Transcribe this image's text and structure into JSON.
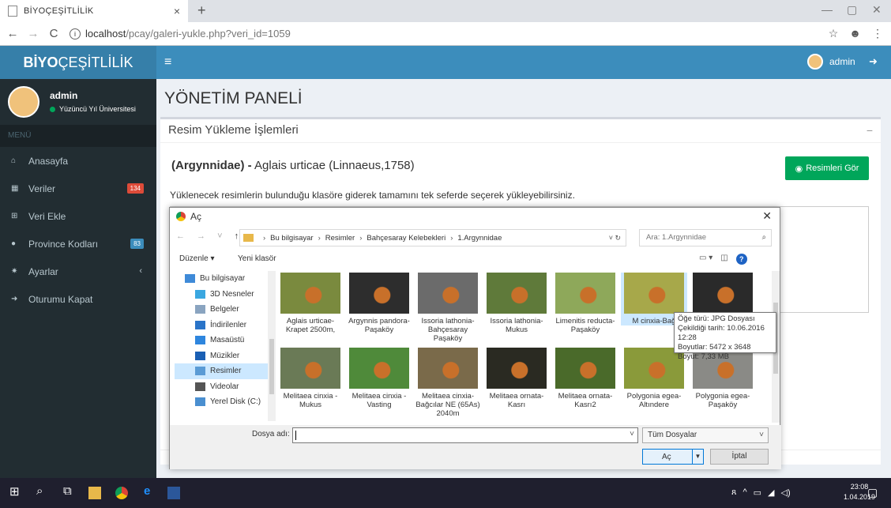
{
  "browser": {
    "tab_title": "BİYOÇEŞİTLİLİK",
    "tab_close": "×",
    "new_tab": "+",
    "url_host": "localhost",
    "url_path": "/pcay/galeri-yukle.php?veri_id=1059",
    "window_min": "—",
    "window_max": "▢",
    "window_close": "✕"
  },
  "app": {
    "brand_bold": "BİYO",
    "brand_rest": "ÇEŞİTLİLİK",
    "menu_toggle": "≡",
    "top_user": "admin",
    "colors": {
      "brand": "#367fa9",
      "header": "#3c8dbc",
      "sidebar": "#222d32",
      "success": "#00a65a",
      "danger": "#dd4b39"
    }
  },
  "sidebar": {
    "user_name": "admin",
    "user_status": "Yüzüncü Yıl Üniversitesi",
    "menu_header": "MENÜ",
    "items": [
      {
        "label": "Anasayfa",
        "icon": "home-icon",
        "glyph": "⌂"
      },
      {
        "label": "Veriler",
        "icon": "table-icon",
        "glyph": "▦",
        "badge": "134",
        "badge_color": "#dd4b39"
      },
      {
        "label": "Veri Ekle",
        "icon": "plus-square-icon",
        "glyph": "⊞"
      },
      {
        "label": "Province Kodları",
        "icon": "map-marker-icon",
        "glyph": "●",
        "badge": "83",
        "badge_color": "#3c8dbc"
      },
      {
        "label": "Ayarlar",
        "icon": "gear-icon",
        "glyph": "✷",
        "chevron": "‹"
      },
      {
        "label": "Oturumu Kapat",
        "icon": "sign-out-icon",
        "glyph": "➜"
      }
    ]
  },
  "main": {
    "page_title": "YÖNETİM PANELİ",
    "box_title": "Resim Yükleme İşlemleri",
    "collapse": "−",
    "family": "(Argynnidae) -",
    "species": "Aglais urticae (Linnaeus,1758)",
    "view_button": "Resimleri Gör",
    "instruction": "Yüklenecek resimlerin bulunduğu klasöre giderek tamamını tek seferde seçerek yükleyebilirsiniz."
  },
  "dialog": {
    "title": "Aç",
    "close": "✕",
    "breadcrumb": [
      "Bu bilgisayar",
      "Resimler",
      "Bahçesaray Kelebekleri",
      "1.Argynnidae"
    ],
    "search_placeholder": "Ara: 1.Argynnidae",
    "organize": "Düzenle ▾",
    "new_folder": "Yeni klasör",
    "nav_items": [
      {
        "label": "Bu bilgisayar",
        "color": "#3f8ad8"
      },
      {
        "label": "3D Nesneler",
        "color": "#3aa7e0"
      },
      {
        "label": "Belgeler",
        "color": "#8aa4c0"
      },
      {
        "label": "İndirilenler",
        "color": "#2a74c8"
      },
      {
        "label": "Masaüstü",
        "color": "#2e86de"
      },
      {
        "label": "Müzikler",
        "color": "#1a5fb4"
      },
      {
        "label": "Resimler",
        "color": "#5a9bd5",
        "selected": true
      },
      {
        "label": "Videolar",
        "color": "#555555"
      },
      {
        "label": "Yerel Disk (C:)",
        "color": "#4a8fd0"
      }
    ],
    "files": [
      {
        "label": "Aglais urticae-Krapet 2500m,",
        "bg": "#7a8a3e"
      },
      {
        "label": "Argynnis pandora-Paşaköy",
        "bg": "#2d2d2d"
      },
      {
        "label": "Issoria lathonia-Bahçesaray Paşaköy",
        "bg": "#6b6b6b"
      },
      {
        "label": "Issoria lathonia-Mukus",
        "bg": "#5f7a3a"
      },
      {
        "label": "Limenitis reducta-Paşaköy",
        "bg": "#8ea85a"
      },
      {
        "label": "M cinxia-Bağ",
        "bg": "#a7a84a",
        "selected": true
      },
      {
        "label": "",
        "bg": "#2a2a2a"
      },
      {
        "label": "Melitaea cinxia -Mukus",
        "bg": "#6a7a56"
      },
      {
        "label": "Melitaea cinxia -Vasting",
        "bg": "#4f8a3a"
      },
      {
        "label": "Melitaea cinxia-Bağcılar NE (65As) 2040m",
        "bg": "#7a6a4a"
      },
      {
        "label": "Melitaea ornata-Kasrı",
        "bg": "#2a2a22"
      },
      {
        "label": "Melitaea ornata-Kasrı2",
        "bg": "#4a6a2a"
      },
      {
        "label": "Polygonia egea-Altındere",
        "bg": "#8a9a3a"
      },
      {
        "label": "Polygonia egea-Paşaköy",
        "bg": "#8a8a86"
      }
    ],
    "tooltip": [
      "Öğe türü: JPG Dosyası",
      "Çekildiği tarih: 10.06.2016 12:28",
      "Boyutlar: 5472 x 3648",
      "Boyut: 7,33 MB"
    ],
    "file_name_label": "Dosya adı:",
    "file_type": "Tüm Dosyalar",
    "open_button": "Aç",
    "cancel_button": "İptal"
  },
  "taskbar": {
    "time": "23:08",
    "date": "1.04.2019"
  }
}
